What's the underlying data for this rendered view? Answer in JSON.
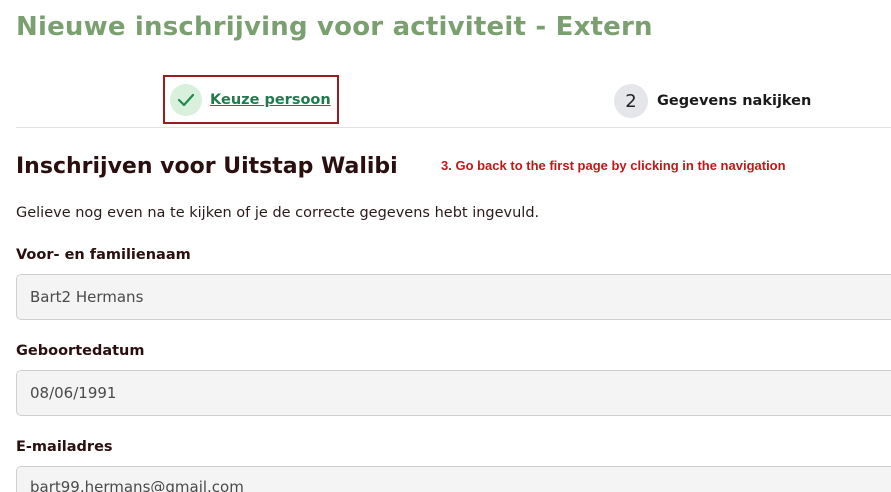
{
  "page": {
    "title": "Nieuwe inschrijving voor activiteit - Extern"
  },
  "stepper": {
    "steps": [
      {
        "label": "Keuze persoon",
        "state": "completed"
      },
      {
        "number": "2",
        "label": "Gegevens nakijken",
        "state": "active"
      }
    ]
  },
  "section": {
    "title": "Inschrijven voor Uitstap Walibi",
    "intro": "Gelieve nog even na te kijken of je de correcte gegevens hebt ingevuld."
  },
  "annotation": {
    "text": "3. Go back to the first page by clicking in the navigation",
    "color": "#c01818"
  },
  "form": {
    "fields": [
      {
        "label": "Voor- en familienaam",
        "value": "Bart2 Hermans"
      },
      {
        "label": "Geboortedatum",
        "value": "08/06/1991"
      },
      {
        "label": "E-mailadres",
        "value": "bart99.hermans@gmail.com"
      }
    ]
  },
  "colors": {
    "title": "#7aa070",
    "link": "#1f7a4e",
    "highlight_border": "#9b1c1c"
  }
}
